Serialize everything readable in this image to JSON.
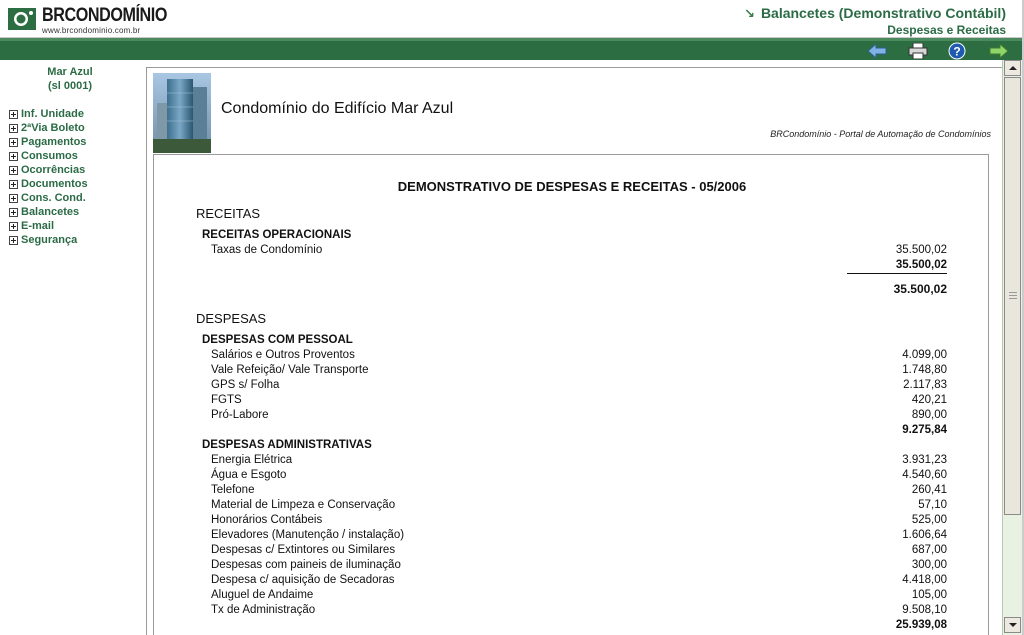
{
  "header": {
    "logo_name": "BRCONDOMÍNIO",
    "logo_url": "www.brcondominio.com.br",
    "title": "Balancetes (Demonstrativo Contábil)",
    "subtitle": "Despesas e Receitas"
  },
  "toolbar": {
    "icons": [
      "back-arrow-icon",
      "printer-icon",
      "help-icon",
      "forward-arrow-icon"
    ]
  },
  "sidebar": {
    "unit_name": "Mar Azul",
    "unit_code": "(sl 0001)",
    "items": [
      {
        "label": "Inf. Unidade"
      },
      {
        "label": "2ªVia Boleto"
      },
      {
        "label": "Pagamentos"
      },
      {
        "label": "Consumos"
      },
      {
        "label": "Ocorrências"
      },
      {
        "label": "Documentos"
      },
      {
        "label": "Cons. Cond."
      },
      {
        "label": "Balancetes"
      },
      {
        "label": "E-mail"
      },
      {
        "label": "Segurança"
      }
    ]
  },
  "banner": {
    "condo_name": "Condomínio do Edifício Mar Azul",
    "portal": "BRCondomínio - Portal de Automação de Condomínios"
  },
  "report": {
    "title": "DEMONSTRATIVO DE DESPESAS E RECEITAS - 05/2006",
    "receitas": {
      "title": "RECEITAS",
      "groups": [
        {
          "title": "RECEITAS OPERACIONAIS",
          "items": [
            {
              "label": "Taxas de Condomínio",
              "value": "35.500,02"
            }
          ],
          "subtotal": "35.500,02"
        }
      ],
      "total": "35.500,02"
    },
    "despesas": {
      "title": "DESPESAS",
      "groups": [
        {
          "title": "DESPESAS COM PESSOAL",
          "items": [
            {
              "label": "Salários e Outros Proventos",
              "value": "4.099,00"
            },
            {
              "label": "Vale Refeição/ Vale Transporte",
              "value": "1.748,80"
            },
            {
              "label": "GPS s/ Folha",
              "value": "2.117,83"
            },
            {
              "label": "FGTS",
              "value": "420,21"
            },
            {
              "label": "Pró-Labore",
              "value": "890,00"
            }
          ],
          "subtotal": "9.275,84"
        },
        {
          "title": "DESPESAS ADMINISTRATIVAS",
          "items": [
            {
              "label": "Energia Elétrica",
              "value": "3.931,23"
            },
            {
              "label": "Água e Esgoto",
              "value": "4.540,60"
            },
            {
              "label": "Telefone",
              "value": "260,41"
            },
            {
              "label": "Material de Limpeza e Conservação",
              "value": "57,10"
            },
            {
              "label": "Honorários Contábeis",
              "value": "525,00"
            },
            {
              "label": "Elevadores (Manutenção / instalação)",
              "value": "1.606,64"
            },
            {
              "label": "Despesas c/ Extintores ou Similares",
              "value": "687,00"
            },
            {
              "label": "Despesas com paineis de iluminação",
              "value": "300,00"
            },
            {
              "label": "Despesa c/ aquisição de Secadoras",
              "value": "4.418,00"
            },
            {
              "label": "Aluguel de Andaime",
              "value": "105,00"
            },
            {
              "label": "Tx de Administração",
              "value": "9.508,10"
            }
          ],
          "subtotal": "25.939,08"
        }
      ]
    }
  },
  "colors": {
    "brand_green": "#2c6e42",
    "text_green": "#2b6b45"
  }
}
